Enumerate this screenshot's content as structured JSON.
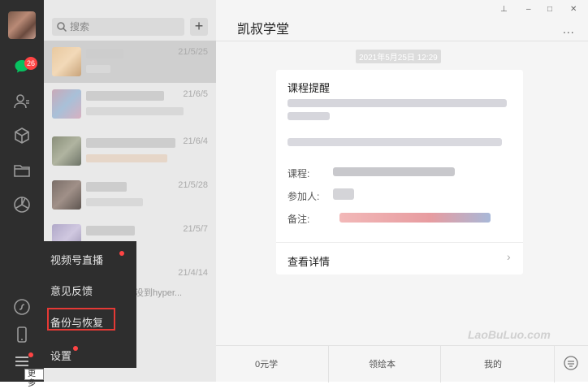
{
  "sidebar": {
    "unread_count": "26",
    "icons": [
      "chat-icon",
      "contacts-icon",
      "favorites-icon",
      "files-icon",
      "moments-icon",
      "mini-program-icon",
      "phone-icon",
      "menu-icon"
    ],
    "tooltip": "更多"
  },
  "chat_list": {
    "search_placeholder": "搜索",
    "add_label": "+",
    "items": [
      {
        "date": "21/5/25",
        "msg": ""
      },
      {
        "date": "21/6/5",
        "msg": ""
      },
      {
        "date": "21/6/4",
        "msg": ""
      },
      {
        "date": "21/5/28",
        "msg": ""
      },
      {
        "date": "21/5/7",
        "msg": ""
      },
      {
        "date": "21/4/14",
        "msg": "没到hyper..."
      }
    ]
  },
  "menu": {
    "items": [
      "视频号直播",
      "意见反馈",
      "备份与恢复",
      "设置"
    ]
  },
  "main": {
    "title": "凯叔学堂",
    "more": "...",
    "timestamp": "2021年5月25日 12:29",
    "card": {
      "title": "课程提醒",
      "course_label": "课程:",
      "participant_label": "参加人:",
      "note_label": "备注:",
      "detail_label": "查看详情"
    },
    "bottom": [
      "0元学",
      "领绘本",
      "我的"
    ]
  },
  "window": {
    "pin": "⊥",
    "minimize": "–",
    "maximize": "□",
    "close": "✕"
  },
  "watermark": "LaoBuLuo.com"
}
